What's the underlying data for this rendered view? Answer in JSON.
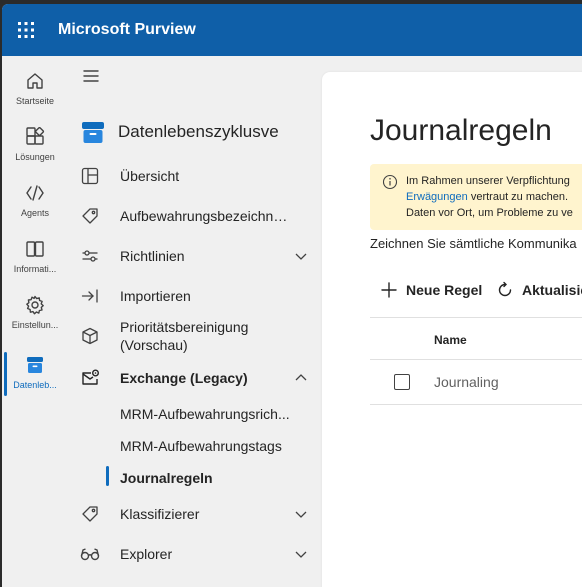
{
  "app": {
    "title": "Microsoft Purview"
  },
  "rail": [
    {
      "label": "Startseite",
      "icon": "home-icon"
    },
    {
      "label": "Lösungen",
      "icon": "apps-icon"
    },
    {
      "label": "Agents",
      "icon": "agents-icon"
    },
    {
      "label": "Informati...",
      "icon": "book-icon"
    },
    {
      "label": "Einstellun...",
      "icon": "gear-icon"
    },
    {
      "label": "Datenleb...",
      "icon": "archive-icon"
    }
  ],
  "nav": {
    "header": "Datenlebenszyklusve",
    "items": {
      "overview": "Übersicht",
      "retention_labels": "Aufbewahrungsbezeichnu...",
      "policies": "Richtlinien",
      "import": "Importieren",
      "priority_cleanup": "Prioritätsbereinigung (Vorschau)",
      "exchange": "Exchange (Legacy)",
      "classifiers": "Klassifizierer",
      "explorer": "Explorer"
    },
    "exchange_sub": {
      "mrm_policies": "MRM-Aufbewahrungsrich...",
      "mrm_tags": "MRM-Aufbewahrungstags",
      "journal_rules": "Journalregeln"
    }
  },
  "main": {
    "title": "Journalregeln",
    "banner": {
      "line1": "Im Rahmen unserer Verpflichtung",
      "line2_link": "Erwägungen",
      "line2_rest": " vertraut zu machen.",
      "line3": "Daten vor Ort, um Probleme zu ve"
    },
    "description": "Zeichnen Sie sämtliche Kommunika",
    "toolbar": {
      "new_rule": "Neue Regel",
      "refresh": "Aktualisie"
    },
    "table": {
      "column_name": "Name",
      "rows": [
        {
          "name": "Journaling"
        }
      ]
    }
  },
  "colors": {
    "topbar": "#0f5fa8",
    "accent": "#0f6cbd",
    "banner": "#fff4ce"
  }
}
